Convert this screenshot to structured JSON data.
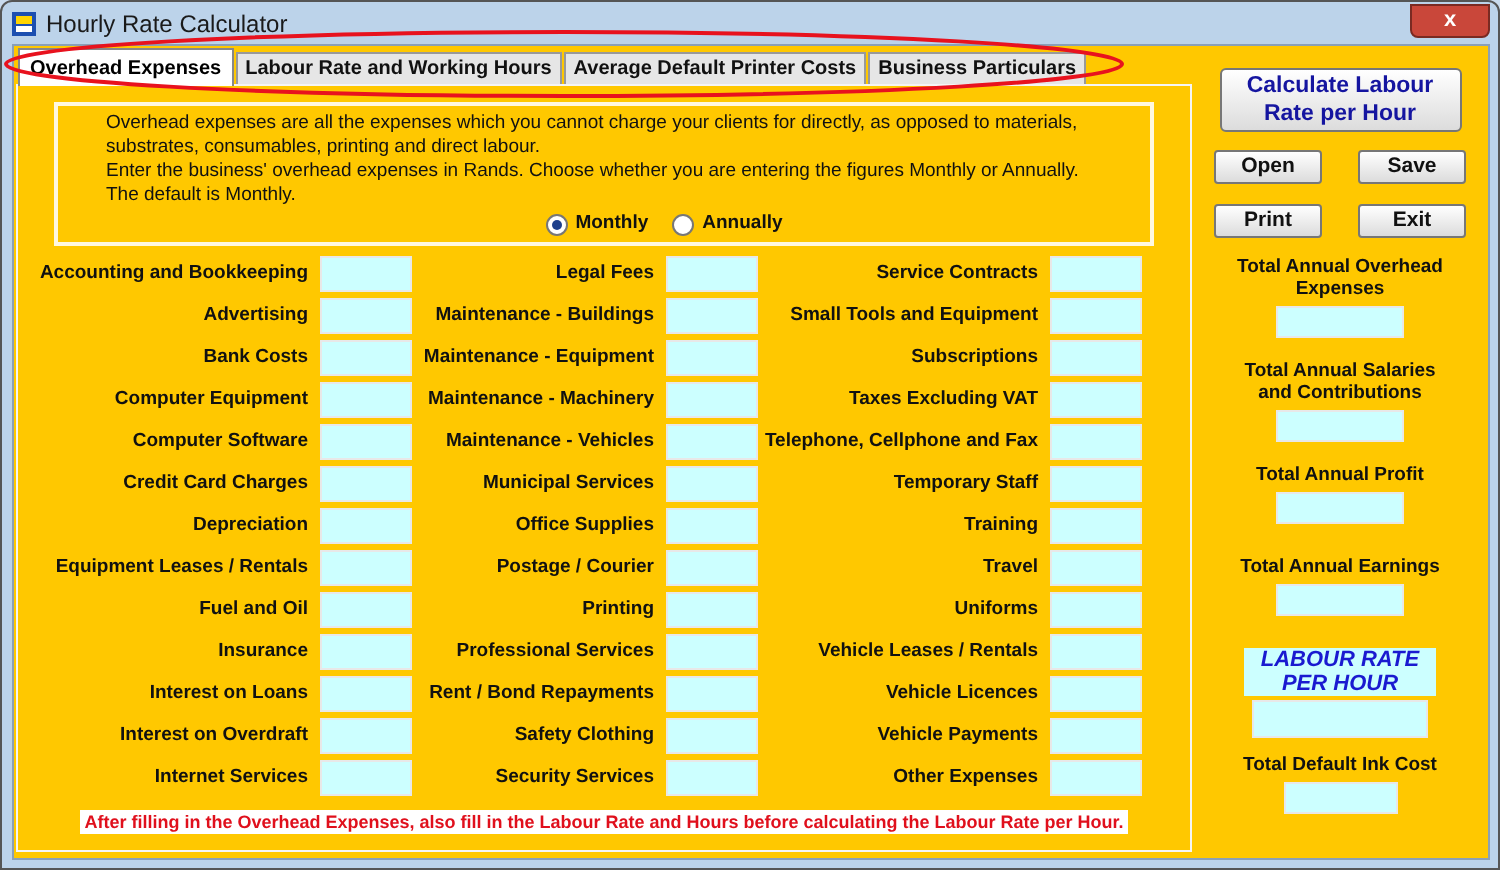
{
  "window": {
    "title": "Hourly Rate Calculator",
    "close": "x"
  },
  "tabs": [
    {
      "label": "Overhead Expenses",
      "selected": true
    },
    {
      "label": "Labour Rate and Working Hours",
      "selected": false
    },
    {
      "label": "Average Default Printer Costs",
      "selected": false
    },
    {
      "label": "Business Particulars",
      "selected": false
    }
  ],
  "tabs_highlighted": true,
  "description": [
    "Overhead expenses are all the expenses which you cannot charge your clients for directly, as opposed to materials, substrates, consumables, printing and direct labour.",
    "Enter the business' overhead expenses in Rands. Choose whether you are entering the figures Monthly or Annually.",
    "The default is Monthly."
  ],
  "period": [
    {
      "label": "Monthly",
      "selected": true
    },
    {
      "label": "Annually",
      "selected": false
    }
  ],
  "expense_columns": [
    [
      "Accounting and Bookkeeping",
      "Advertising",
      "Bank Costs",
      "Computer Equipment",
      "Computer Software",
      "Credit Card Charges",
      "Depreciation",
      "Equipment Leases / Rentals",
      "Fuel and Oil",
      "Insurance",
      "Interest on Loans",
      "Interest on Overdraft",
      "Internet Services"
    ],
    [
      "Legal Fees",
      "Maintenance - Buildings",
      "Maintenance - Equipment",
      "Maintenance - Machinery",
      "Maintenance - Vehicles",
      "Municipal Services",
      "Office Supplies",
      "Postage / Courier",
      "Printing",
      "Professional Services",
      "Rent / Bond Repayments",
      "Safety Clothing",
      "Security Services"
    ],
    [
      "Service Contracts",
      "Small Tools and Equipment",
      "Subscriptions",
      "Taxes Excluding VAT",
      "Telephone, Cellphone and Fax",
      "Temporary Staff",
      "Training",
      "Travel",
      "Uniforms",
      "Vehicle Leases / Rentals",
      "Vehicle Licences",
      "Vehicle Payments",
      "Other Expenses"
    ]
  ],
  "note": "After filling in the Overhead Expenses, also fill in the Labour Rate and Hours before calculating the Labour Rate per Hour.",
  "calculate_button": "Calculate Labour Rate per Hour",
  "buttons": [
    "Open",
    "Save",
    "Print",
    "Exit"
  ],
  "totals": [
    {
      "kind": "plain",
      "label": "Total Annual Overhead Expenses"
    },
    {
      "kind": "plain",
      "label": "Total Annual Salaries and Contributions"
    },
    {
      "kind": "plain",
      "label": "Total Annual Profit"
    },
    {
      "kind": "plain",
      "label": "Total Annual Earnings"
    },
    {
      "kind": "highlight",
      "label": "LABOUR RATE PER HOUR"
    },
    {
      "kind": "plain",
      "label": "Total Default Ink Cost"
    }
  ]
}
